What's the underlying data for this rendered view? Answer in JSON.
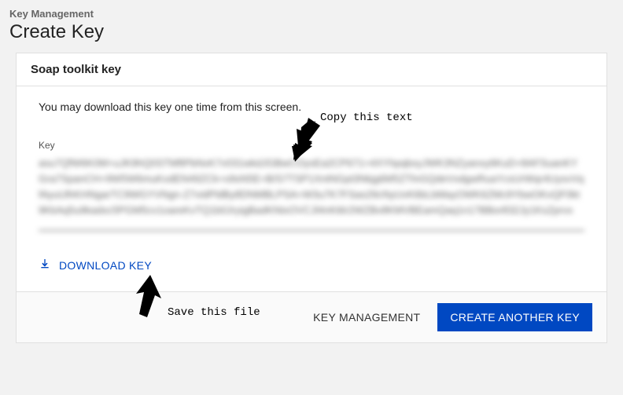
{
  "breadcrumb": "Key Management",
  "page_title": "Create Key",
  "card": {
    "title": "Soap toolkit key",
    "instruction": "You may download this key one time from this screen.",
    "field_label": "Key",
    "key_value": "asu7QfW6K0M+uJK9hQ0STMftPbNxK7v031wkdJGBwCOysEa2CP671=4XYhpqbxyJWK3NZyanxy6KuD+8AFSuanKYGra7SpanCH+9W5W6muKxdEN49ZCk+s9sN5E=B/S7TSP1XntNGpt3Nkjg6M5ZTlnGQdeVxdgwRuaYcsUrWqr4UysvVqfAyuUlhKHNgarTC9WGYVNgn-Z7vidPldBy8DNMBLPSA=W3u7K7FSas29cNyUvK6bLbMayOWK6ZMc9YbwOKvQF0kt9KkAq5u9kadxc5PGM5cv1oareKvTQ1b0JryigBadKNtxOVCJl4nKt6r2WZBv8KMVBEamQaq1n17BBor832Jy1KsZprvx",
    "download_label": "DOWNLOAD KEY"
  },
  "footer": {
    "key_mgmt": "KEY MANAGEMENT",
    "create_another": "CREATE ANOTHER KEY"
  },
  "annotations": {
    "copy_text": "Copy this text",
    "save_file": "Save this file"
  }
}
